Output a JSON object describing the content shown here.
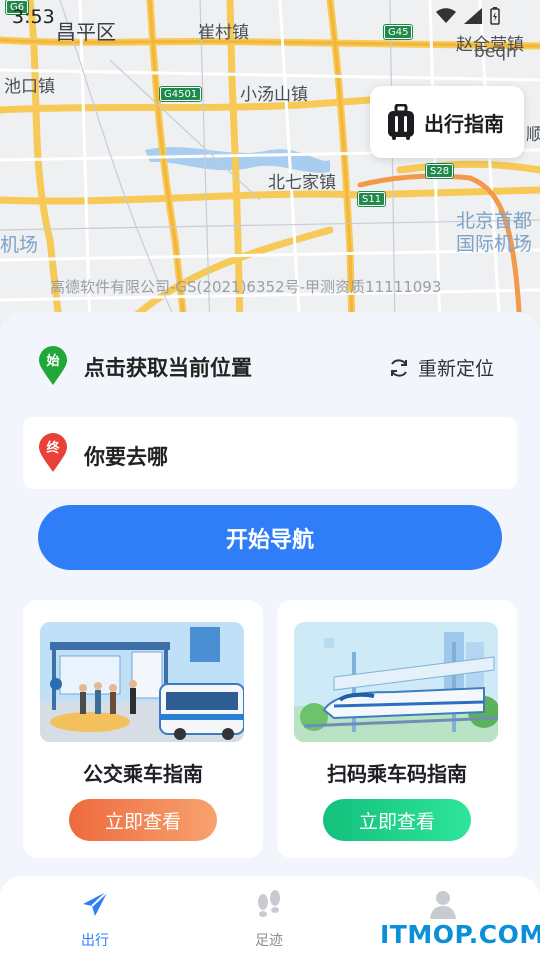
{
  "status_bar": {
    "time": "3:53"
  },
  "map": {
    "labels": {
      "changping": "昌平区",
      "cuicun": "崔村镇",
      "zhaoquanying": "赵全营镇",
      "chikou": "池口镇",
      "xiaotangshan": "小汤山镇",
      "beiqijia": "北七家镇",
      "airport_line1": "北京首都",
      "airport_line2": "国际机场",
      "jichang": "机场",
      "shun": "顺"
    },
    "shields": {
      "g6": "G6",
      "g45": "G45",
      "g4501": "G4501",
      "s28": "S28",
      "s11": "S11"
    },
    "overlay_text": "beqn",
    "copyright": "高德软件有限公司-GS(2021)6352号-甲测资质11111093"
  },
  "guide_button": {
    "label": "出行指南",
    "icon": "luggage-icon"
  },
  "route": {
    "start_marker": "始",
    "start_text": "点击获取当前位置",
    "relocate_label": "重新定位",
    "end_marker": "终",
    "destination_placeholder": "你要去哪"
  },
  "navigate_button": "开始导航",
  "cards": [
    {
      "title": "公交乘车指南",
      "button": "立即查看",
      "illustration": "bus-stop-illustration"
    },
    {
      "title": "扫码乘车码指南",
      "button": "立即查看",
      "illustration": "train-illustration"
    }
  ],
  "tabs": [
    {
      "label": "出行",
      "icon": "paper-plane-icon"
    },
    {
      "label": "足迹",
      "icon": "footprints-icon"
    },
    {
      "label": "",
      "icon": "user-icon"
    }
  ],
  "watermark": "ITMOP.COM",
  "colors": {
    "accent": "#2f7ef8",
    "start_pin": "#22a83a",
    "end_pin": "#e8413a",
    "card1_button": "#f07a4a",
    "card2_button": "#1fcf8a"
  }
}
